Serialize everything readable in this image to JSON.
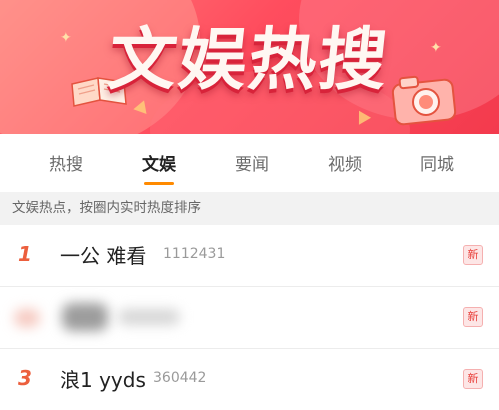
{
  "banner": {
    "title": "文娱热搜"
  },
  "tabs": [
    {
      "label": "热搜"
    },
    {
      "label": "文娱"
    },
    {
      "label": "要闻"
    },
    {
      "label": "视频"
    },
    {
      "label": "同城"
    }
  ],
  "subheader": {
    "text": "文娱热点，按圈内实时热度排序"
  },
  "list": [
    {
      "rank": "1",
      "title": "一公 难看",
      "count": "1112431",
      "badge": "新"
    },
    {
      "rank": "",
      "title": "",
      "count": "",
      "badge": "新"
    },
    {
      "rank": "3",
      "title": "浪1 yyds",
      "count": "360442",
      "badge": "新"
    }
  ],
  "colors": {
    "accent": "#ff8a00",
    "rank": "#ec5f3d",
    "banner": "#f33a4d",
    "badge": "#e8413c"
  },
  "icons": [
    "book-icon",
    "camera-icon"
  ]
}
